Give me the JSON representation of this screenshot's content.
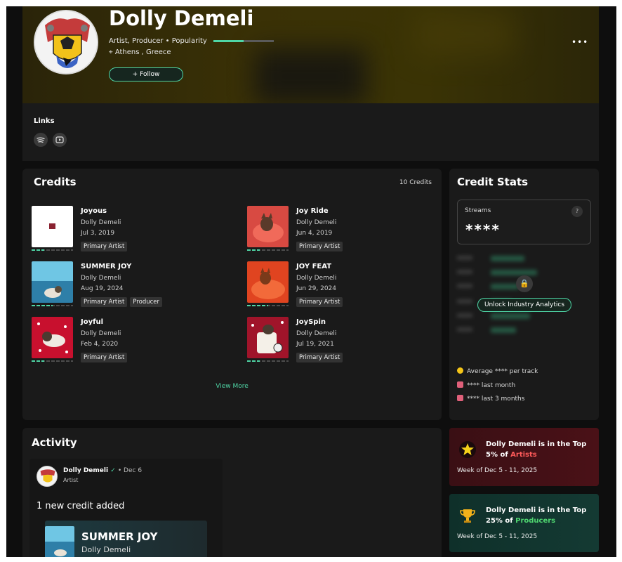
{
  "artist": {
    "name": "Dolly Demeli",
    "roles": "Artist, Producer • Popularity",
    "popularity": 0.5,
    "location": "Athens , Greece",
    "follow_label": "Follow",
    "more_label": "•••"
  },
  "links": {
    "title": "Links",
    "items": [
      {
        "icon": "spotify-icon"
      },
      {
        "icon": "youtube-icon"
      }
    ]
  },
  "credits": {
    "title": "Credits",
    "count_label": "10 Credits",
    "view_more": "View More",
    "items": [
      {
        "title": "Joyous",
        "artist": "Dolly Demeli",
        "date": "Jul 3, 2019",
        "tags": [
          "Primary Artist"
        ],
        "popularity": 0.3
      },
      {
        "title": "Joy Ride",
        "artist": "Dolly Demeli",
        "date": "Jun 4, 2019",
        "tags": [
          "Primary Artist"
        ],
        "popularity": 0.3
      },
      {
        "title": "SUMMER JOY",
        "artist": "Dolly Demeli",
        "date": "Aug 19, 2024",
        "tags": [
          "Primary Artist",
          "Producer"
        ],
        "popularity": 0.5
      },
      {
        "title": "JOY FEAT",
        "artist": "Dolly Demeli",
        "date": "Jun 29, 2024",
        "tags": [
          "Primary Artist"
        ],
        "popularity": 0.5
      },
      {
        "title": "Joyful",
        "artist": "Dolly Demeli",
        "date": "Feb 4, 2020",
        "tags": [
          "Primary Artist"
        ],
        "popularity": 0.3
      },
      {
        "title": "JoySpin",
        "artist": "Dolly Demeli",
        "date": "Jul 19, 2021",
        "tags": [
          "Primary Artist"
        ],
        "popularity": 0.3
      }
    ]
  },
  "stats": {
    "title": "Credit Stats",
    "streams_label": "Streams",
    "streams_value": "****",
    "help": "?",
    "unlock_label": "Unlock Industry Analytics",
    "lines": [
      {
        "text": "Average **** per track",
        "color": "#f5c518"
      },
      {
        "text": "**** last month",
        "color": "#e0607a"
      },
      {
        "text": "**** last 3 months",
        "color": "#e0607a"
      }
    ]
  },
  "activity": {
    "title": "Activity",
    "post": {
      "name": "Dolly Demeli",
      "verified": "✓",
      "date": "• Dec 6",
      "role": "Artist",
      "text": "1 new credit added",
      "card_title": "SUMMER JOY",
      "card_artist": "Dolly Demeli"
    }
  },
  "top_cards": [
    {
      "pre": "Dolly Demeli is in the Top 5% of ",
      "highlight": "Artists",
      "week": "Week of Dec 5 - 11, 2025",
      "icon": "star-icon"
    },
    {
      "pre": "Dolly Demeli is in the Top 25% of ",
      "highlight": "Producers",
      "week": "Week of Dec 5 - 11, 2025",
      "icon": "trophy-icon"
    }
  ]
}
